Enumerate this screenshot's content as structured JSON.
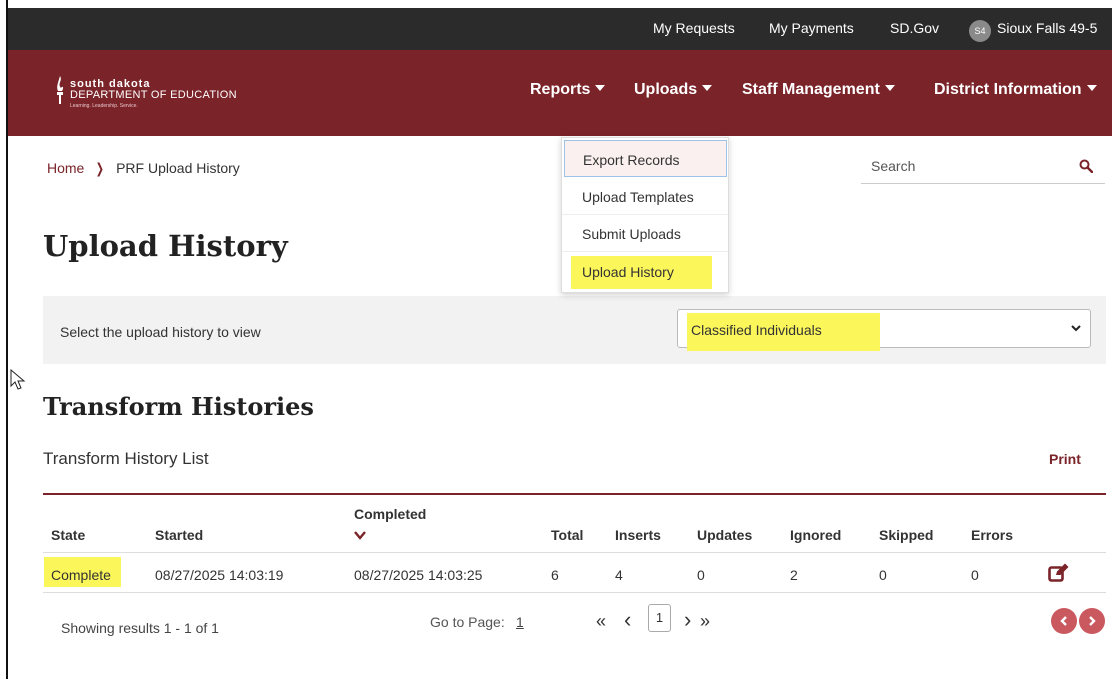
{
  "colors": {
    "brand": "#7a2329",
    "utility_bar": "#2b2b2b",
    "highlight": "#fbf65a",
    "pager_button": "#c9585f"
  },
  "utility_nav": {
    "my_requests": "My Requests",
    "my_payments": "My Payments",
    "sd_gov": "SD.Gov",
    "avatar_initials": "S4",
    "district": "Sioux Falls 49-5"
  },
  "logo": {
    "line1": "south dakota",
    "line2": "DEPARTMENT OF EDUCATION",
    "tagline": "Learning. Leadership. Service."
  },
  "main_nav": {
    "reports": "Reports",
    "uploads": "Uploads",
    "staff_management": "Staff Management",
    "district_information": "District Information"
  },
  "uploads_menu": {
    "items": [
      "Export Records",
      "Upload Templates",
      "Submit Uploads",
      "Upload History"
    ],
    "active_item": "Export Records",
    "highlighted_item": "Upload History"
  },
  "breadcrumb": {
    "home": "Home",
    "separator": "❯",
    "current": "PRF Upload History"
  },
  "search": {
    "placeholder": "Search",
    "icon": "search-icon"
  },
  "page": {
    "title": "Upload History"
  },
  "filter": {
    "label": "Select the upload history to view",
    "selected": "Classified Individuals"
  },
  "section": {
    "title": "Transform Histories",
    "list_title": "Transform History List",
    "print": "Print"
  },
  "table": {
    "headers": {
      "state": "State",
      "started": "Started",
      "completed": "Completed",
      "total": "Total",
      "inserts": "Inserts",
      "updates": "Updates",
      "ignored": "Ignored",
      "skipped": "Skipped",
      "errors": "Errors"
    },
    "sort_column": "completed",
    "rows": [
      {
        "state": "Complete",
        "started": "08/27/2025 14:03:19",
        "completed": "08/27/2025 14:03:25",
        "total": "6",
        "inserts": "4",
        "updates": "0",
        "ignored": "2",
        "skipped": "0",
        "errors": "0"
      }
    ]
  },
  "pagination": {
    "summary": "Showing results 1 - 1 of 1",
    "goto_label": "Go to Page:",
    "goto_value": "1",
    "first": "«",
    "prev": "‹",
    "current": "1",
    "next": "›",
    "last": "»"
  }
}
